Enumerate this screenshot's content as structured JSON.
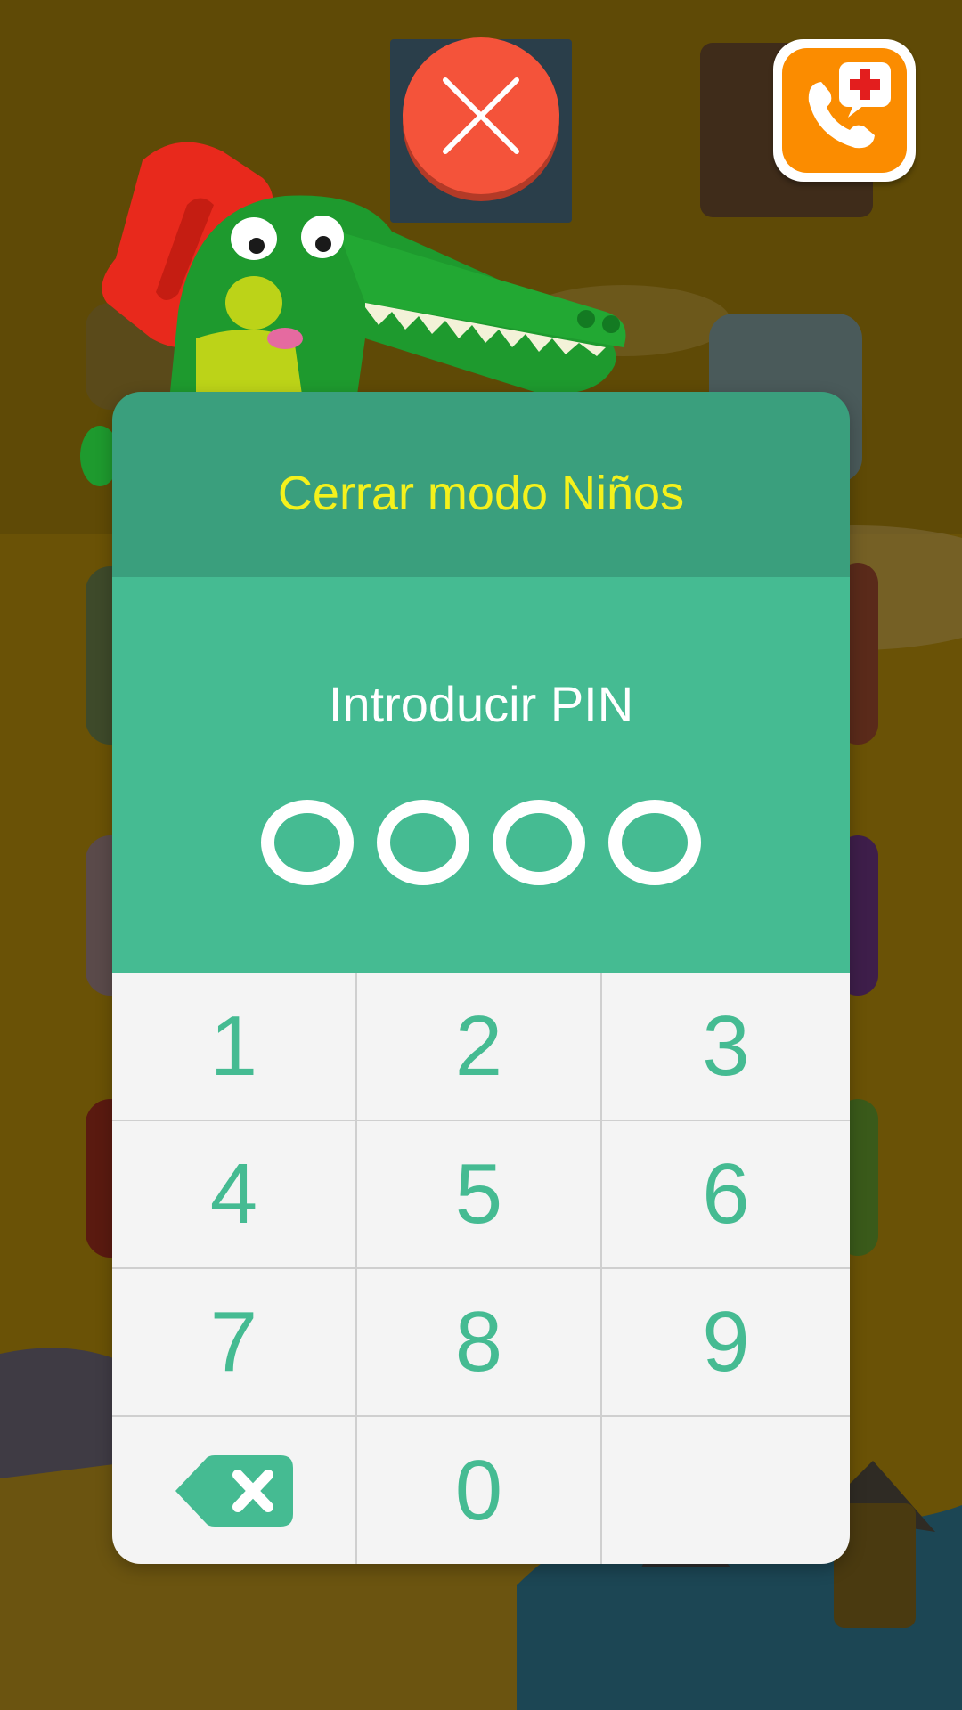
{
  "dialog": {
    "title": "Cerrar modo Niños",
    "pin_label": "Introducir PIN",
    "pin_length": 4,
    "entered_digits": 0
  },
  "keypad": {
    "keys": [
      "1",
      "2",
      "3",
      "4",
      "5",
      "6",
      "7",
      "8",
      "9",
      "0"
    ],
    "backspace_icon": "backspace-icon"
  },
  "top_buttons": {
    "close_icon": "close-icon",
    "help_icon": "phone-medical-icon"
  },
  "colors": {
    "header_green": "#3a9f7d",
    "body_green": "#45bb92",
    "title_yellow": "#f4f11c",
    "close_red": "#f4533a",
    "help_orange": "#fb8c00"
  }
}
